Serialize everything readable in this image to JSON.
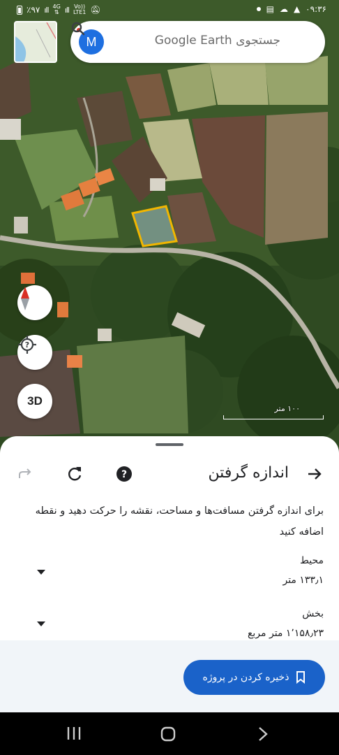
{
  "status_bar": {
    "battery": "٪۹۷",
    "network_top": "4G",
    "network_bottom": "LTE1",
    "volte_top": "Vo))",
    "time": "۰۹:۳۶"
  },
  "search": {
    "avatar_letter": "M",
    "placeholder": "جستجوی Google Earth"
  },
  "map": {
    "scale_label": "۱۰۰ متر",
    "three_d_label": "3D"
  },
  "sheet": {
    "title": "اندازه گرفتن",
    "instructions": "برای اندازه گرفتن مسافت‌ها و مساحت، نقشه را حرکت دهید و نقطه اضافه کنید",
    "measurements": [
      {
        "label": "محیط",
        "value": "۱۳۳٫۱ متر"
      },
      {
        "label": "بخش",
        "value": "۱٬۱۵۸٫۲۳ متر مربع"
      }
    ],
    "save_label": "ذخیره کردن در پروژه"
  },
  "colors": {
    "accent": "#1a62c9",
    "polygon": "#f2b600",
    "avatar": "#1e6fe0"
  }
}
